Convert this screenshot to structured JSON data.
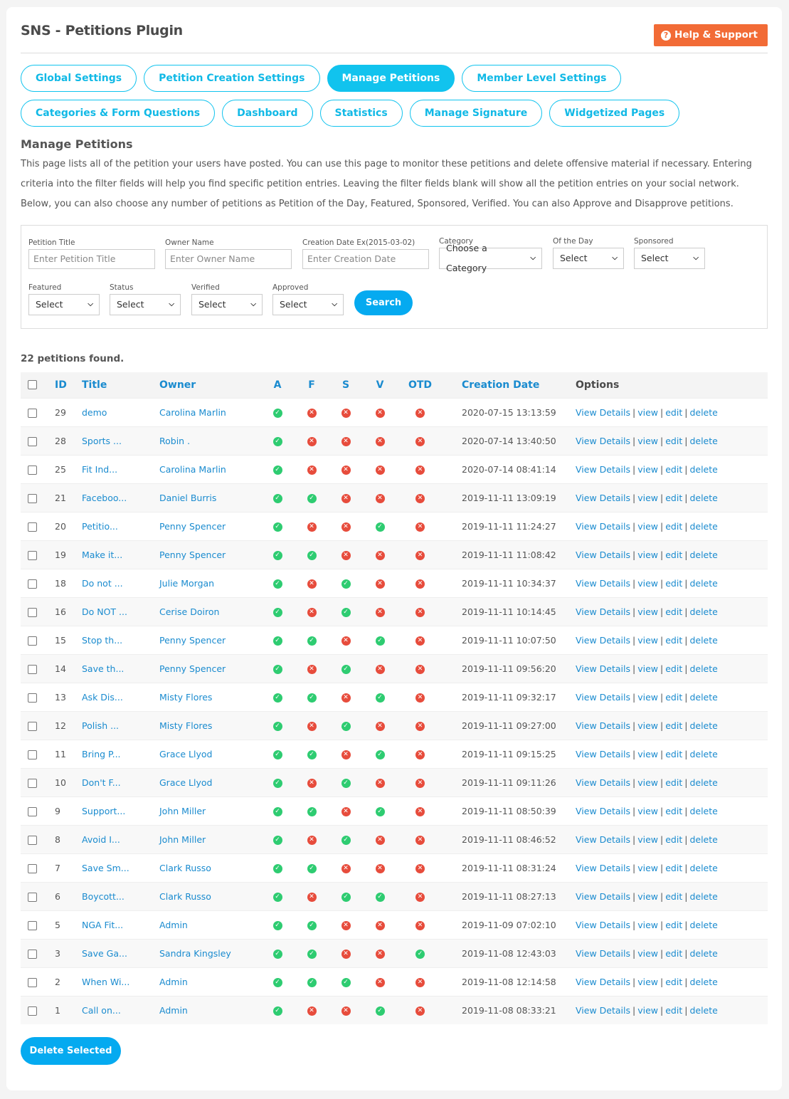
{
  "header": {
    "title": "SNS - Petitions Plugin",
    "help_label": "Help & Support",
    "help_icon": "question-circle-icon"
  },
  "tabs": [
    {
      "label": "Global Settings",
      "active": false
    },
    {
      "label": "Petition Creation Settings",
      "active": false
    },
    {
      "label": "Manage Petitions",
      "active": true
    },
    {
      "label": "Member Level Settings",
      "active": false
    },
    {
      "label": "Categories & Form Questions",
      "active": false
    },
    {
      "label": "Dashboard",
      "active": false
    },
    {
      "label": "Statistics",
      "active": false
    },
    {
      "label": "Manage Signature",
      "active": false
    },
    {
      "label": "Widgetized Pages",
      "active": false
    }
  ],
  "section": {
    "title": "Manage Petitions",
    "description": [
      "This page lists all of the petition your users have posted. You can use this page to monitor these petitions and delete offensive material if necessary. Entering criteria into the filter fields will help you find specific petition entries. Leaving the filter fields blank will show all the petition entries on your social network.",
      "Below, you can also choose any number of petitions as Petition of the Day, Featured, Sponsored, Verified. You can also Approve and Disapprove petitions."
    ]
  },
  "filters": {
    "petition_title": {
      "label": "Petition Title",
      "placeholder": "Enter Petition Title",
      "value": ""
    },
    "owner_name": {
      "label": "Owner Name",
      "placeholder": "Enter Owner Name",
      "value": ""
    },
    "creation_date": {
      "label": "Creation Date Ex(2015-03-02)",
      "placeholder": "Enter Creation Date",
      "value": ""
    },
    "category": {
      "label": "Category",
      "selected": "Choose a Category"
    },
    "of_the_day": {
      "label": "Of the Day",
      "selected": "Select"
    },
    "sponsored": {
      "label": "Sponsored",
      "selected": "Select"
    },
    "featured": {
      "label": "Featured",
      "selected": "Select"
    },
    "status": {
      "label": "Status",
      "selected": "Select"
    },
    "verified": {
      "label": "Verified",
      "selected": "Select"
    },
    "approved": {
      "label": "Approved",
      "selected": "Select"
    },
    "search_label": "Search"
  },
  "results": {
    "count_text": "22 petitions found."
  },
  "table": {
    "columns": {
      "id": "ID",
      "title": "Title",
      "owner": "Owner",
      "a": "A",
      "f": "F",
      "s": "S",
      "v": "V",
      "otd": "OTD",
      "date": "Creation Date",
      "options": "Options"
    },
    "option_links": [
      "View Details",
      "view",
      "edit",
      "delete"
    ],
    "status_colors": {
      "yes": "#2ecc71",
      "no": "#e74c3c"
    },
    "rows": [
      {
        "id": "29",
        "title": "demo",
        "owner": "Carolina Marlin",
        "a": true,
        "f": false,
        "s": false,
        "v": false,
        "otd": false,
        "date": "2020-07-15 13:13:59"
      },
      {
        "id": "28",
        "title": "Sports ...",
        "owner": "Robin .",
        "a": true,
        "f": false,
        "s": false,
        "v": false,
        "otd": false,
        "date": "2020-07-14 13:40:50"
      },
      {
        "id": "25",
        "title": "Fit Ind...",
        "owner": "Carolina Marlin",
        "a": true,
        "f": false,
        "s": false,
        "v": false,
        "otd": false,
        "date": "2020-07-14 08:41:14"
      },
      {
        "id": "21",
        "title": "Faceboo...",
        "owner": "Daniel Burris",
        "a": true,
        "f": true,
        "s": false,
        "v": false,
        "otd": false,
        "date": "2019-11-11 13:09:19"
      },
      {
        "id": "20",
        "title": "Petitio...",
        "owner": "Penny Spencer",
        "a": true,
        "f": false,
        "s": false,
        "v": true,
        "otd": false,
        "date": "2019-11-11 11:24:27"
      },
      {
        "id": "19",
        "title": "Make it...",
        "owner": "Penny Spencer",
        "a": true,
        "f": true,
        "s": false,
        "v": false,
        "otd": false,
        "date": "2019-11-11 11:08:42"
      },
      {
        "id": "18",
        "title": "Do not ...",
        "owner": "Julie Morgan",
        "a": true,
        "f": false,
        "s": true,
        "v": false,
        "otd": false,
        "date": "2019-11-11 10:34:37"
      },
      {
        "id": "16",
        "title": "Do NOT ...",
        "owner": "Cerise Doiron",
        "a": true,
        "f": false,
        "s": true,
        "v": false,
        "otd": false,
        "date": "2019-11-11 10:14:45"
      },
      {
        "id": "15",
        "title": "Stop th...",
        "owner": "Penny Spencer",
        "a": true,
        "f": true,
        "s": false,
        "v": true,
        "otd": false,
        "date": "2019-11-11 10:07:50"
      },
      {
        "id": "14",
        "title": "Save th...",
        "owner": "Penny Spencer",
        "a": true,
        "f": false,
        "s": true,
        "v": false,
        "otd": false,
        "date": "2019-11-11 09:56:20"
      },
      {
        "id": "13",
        "title": "Ask Dis...",
        "owner": "Misty Flores",
        "a": true,
        "f": true,
        "s": false,
        "v": true,
        "otd": false,
        "date": "2019-11-11 09:32:17"
      },
      {
        "id": "12",
        "title": "Polish ...",
        "owner": "Misty Flores",
        "a": true,
        "f": false,
        "s": true,
        "v": false,
        "otd": false,
        "date": "2019-11-11 09:27:00"
      },
      {
        "id": "11",
        "title": "Bring P...",
        "owner": "Grace Llyod",
        "a": true,
        "f": true,
        "s": false,
        "v": true,
        "otd": false,
        "date": "2019-11-11 09:15:25"
      },
      {
        "id": "10",
        "title": "Don't F...",
        "owner": "Grace Llyod",
        "a": true,
        "f": false,
        "s": true,
        "v": false,
        "otd": false,
        "date": "2019-11-11 09:11:26"
      },
      {
        "id": "9",
        "title": "Support...",
        "owner": "John Miller",
        "a": true,
        "f": true,
        "s": false,
        "v": true,
        "otd": false,
        "date": "2019-11-11 08:50:39"
      },
      {
        "id": "8",
        "title": "Avoid I...",
        "owner": "John Miller",
        "a": true,
        "f": false,
        "s": true,
        "v": false,
        "otd": false,
        "date": "2019-11-11 08:46:52"
      },
      {
        "id": "7",
        "title": "Save Sm...",
        "owner": "Clark Russo",
        "a": true,
        "f": true,
        "s": false,
        "v": false,
        "otd": false,
        "date": "2019-11-11 08:31:24"
      },
      {
        "id": "6",
        "title": "Boycott...",
        "owner": "Clark Russo",
        "a": true,
        "f": false,
        "s": true,
        "v": true,
        "otd": false,
        "date": "2019-11-11 08:27:13"
      },
      {
        "id": "5",
        "title": "NGA Fit...",
        "owner": "Admin",
        "a": true,
        "f": true,
        "s": false,
        "v": false,
        "otd": false,
        "date": "2019-11-09 07:02:10"
      },
      {
        "id": "3",
        "title": "Save Ga...",
        "owner": "Sandra Kingsley",
        "a": true,
        "f": true,
        "s": false,
        "v": false,
        "otd": true,
        "date": "2019-11-08 12:43:03"
      },
      {
        "id": "2",
        "title": "When Wi...",
        "owner": "Admin",
        "a": true,
        "f": true,
        "s": true,
        "v": false,
        "otd": false,
        "date": "2019-11-08 12:14:58"
      },
      {
        "id": "1",
        "title": "Call on...",
        "owner": "Admin",
        "a": true,
        "f": false,
        "s": false,
        "v": true,
        "otd": false,
        "date": "2019-11-08 08:33:21"
      }
    ]
  },
  "footer": {
    "delete_selected_label": "Delete Selected"
  }
}
